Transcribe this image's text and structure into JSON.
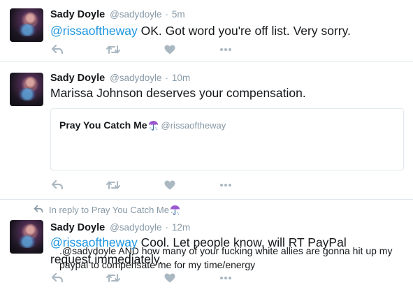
{
  "tweets": [
    {
      "name": "Sady Doyle",
      "handle": "@sadydoyle",
      "sep": "·",
      "time": "5m",
      "mention": "@rissaoftheway",
      "text": " OK. Got word you're off list. Very sorry."
    },
    {
      "name": "Sady Doyle",
      "handle": "@sadydoyle",
      "sep": "·",
      "time": "10m",
      "text": "Marissa Johnson deserves your compensation.",
      "quote": {
        "name": "Pray You Catch Me",
        "handle": "@rissaoftheway",
        "text": ".@sadydoyle AND how many of your fucking white allies are gonna hit up my paypal to compensate me for my time/energy"
      }
    },
    {
      "reply_prefix": "In reply to Pray You Catch Me",
      "name": "Sady Doyle",
      "handle": "@sadydoyle",
      "sep": "·",
      "time": "12m",
      "mention": "@rissaoftheway",
      "text": " Cool. Let people know, will RT PayPal request immediately."
    }
  ],
  "icons": {
    "reply": "reply-icon",
    "retweet": "retweet-icon",
    "like": "heart-icon",
    "more": "more-icon",
    "umbrella": "umbrella-emoji"
  },
  "colors": {
    "link": "#1b95e0",
    "meta": "#8899a6",
    "icon": "#aab8c2",
    "divider": "#e1e8ed",
    "umbrella": "#9b59d0"
  }
}
